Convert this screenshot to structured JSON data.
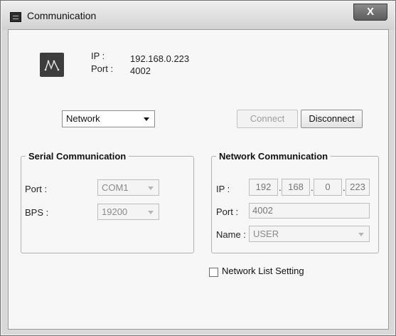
{
  "window": {
    "title": "Communication",
    "close_glyph": "X"
  },
  "device_info": {
    "logo_icon": "device-logo-icon",
    "ip_label": "IP :",
    "ip_value": "192.168.0.223",
    "port_label": "Port :",
    "port_value": "4002"
  },
  "mode_select": {
    "value": "Network"
  },
  "buttons": {
    "connect": "Connect",
    "disconnect": "Disconnect"
  },
  "serial": {
    "title": "Serial Communication",
    "port_label": "Port :",
    "port_value": "COM1",
    "bps_label": "BPS :",
    "bps_value": "19200"
  },
  "network": {
    "title": "Network Communication",
    "ip_label": "IP :",
    "ip_octets": [
      "192",
      "168",
      "0",
      "223"
    ],
    "ip_separator": ".",
    "port_label": "Port :",
    "port_value": "4002",
    "name_label": "Name :",
    "name_value": "USER"
  },
  "network_list": {
    "label": "Network List Setting",
    "checked": false
  }
}
